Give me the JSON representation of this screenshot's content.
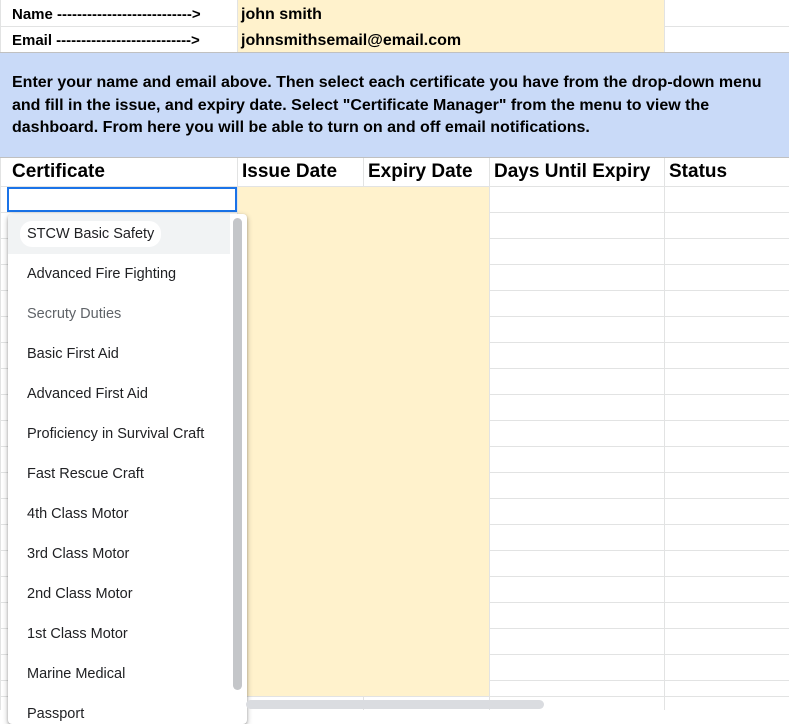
{
  "header": {
    "name_label": "Name --------------------------->",
    "name_value": "john smith",
    "email_label": "Email  --------------------------->",
    "email_value": "johnsmithsemail@email.com"
  },
  "instructions": "Enter your name and email above. Then select each certificate you have from the drop-down menu and fill in the issue, and expiry date. Select \"Certificate Manager\" from the menu to view the dashboard. From here you will be able to turn on and off email notifications.",
  "columns": {
    "certificate": "Certificate",
    "issue_date": "Issue Date",
    "expiry_date": "Expiry Date",
    "days_until_expiry": "Days Until Expiry",
    "status": "Status"
  },
  "active_cell_value": "",
  "dropdown": {
    "items": [
      {
        "label": "STCW Basic Safety",
        "state": "selected"
      },
      {
        "label": "Advanced Fire Fighting",
        "state": "normal"
      },
      {
        "label": "Secruty Duties",
        "state": "muted"
      },
      {
        "label": "Basic First Aid",
        "state": "normal"
      },
      {
        "label": "Advanced First Aid",
        "state": "normal"
      },
      {
        "label": "Proficiency in Survival Craft",
        "state": "normal"
      },
      {
        "label": "Fast Rescue Craft",
        "state": "normal"
      },
      {
        "label": "4th Class Motor",
        "state": "normal"
      },
      {
        "label": "3rd Class Motor",
        "state": "normal"
      },
      {
        "label": "2nd Class Motor",
        "state": "normal"
      },
      {
        "label": "1st Class Motor",
        "state": "normal"
      },
      {
        "label": "Marine Medical",
        "state": "normal"
      },
      {
        "label": "Passport",
        "state": "normal"
      }
    ]
  },
  "colors": {
    "banner": "#c9daf8",
    "input_fill": "#fff2cc",
    "active_border": "#1a73e8"
  }
}
